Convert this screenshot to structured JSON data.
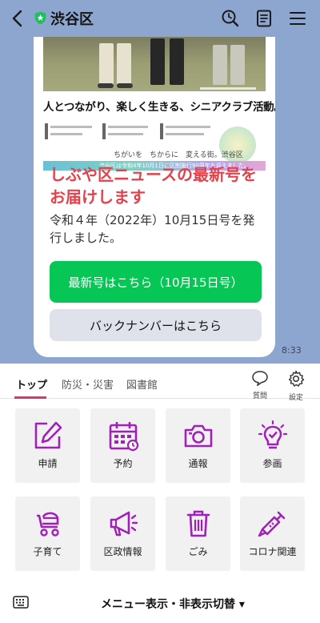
{
  "header": {
    "title": "渋谷区",
    "icons": [
      "back-icon",
      "verified-badge-icon",
      "search-clock-icon",
      "notes-icon",
      "menu-icon"
    ]
  },
  "message": {
    "leaflet_headline": "人とつながり、楽しく生きる、シニアクラブ活動。",
    "leaflet_slogan": "ちがいを　ちからに　変える街。渋谷区",
    "leaflet_stripe": "渋谷区は令和4年10月1日に区制施行90周年を迎えました。",
    "news_title": "しぶや区ニュースの最新号をお届けします",
    "news_desc": "令和４年（2022年）10月15日号を発行しました。",
    "primary_button": "最新号はこちら（10月15日号）",
    "secondary_button": "バックナンバーはこちら",
    "time": "8:33"
  },
  "richmenu": {
    "tabs": [
      "トップ",
      "防災・災害",
      "図書館"
    ],
    "active_tab": 0,
    "tools": [
      {
        "label": "質問",
        "icon": "chat-bubble-icon"
      },
      {
        "label": "設定",
        "icon": "gear-icon"
      }
    ],
    "tiles": [
      {
        "label": "申請",
        "icon": "edit-icon"
      },
      {
        "label": "予約",
        "icon": "calendar-icon"
      },
      {
        "label": "通報",
        "icon": "camera-icon"
      },
      {
        "label": "参画",
        "icon": "idea-bulb-icon"
      },
      {
        "label": "子育て",
        "icon": "stroller-icon"
      },
      {
        "label": "区政情報",
        "icon": "megaphone-icon"
      },
      {
        "label": "ごみ",
        "icon": "trash-icon"
      },
      {
        "label": "コロナ関連",
        "icon": "syringe-icon"
      }
    ],
    "accent_color": "#a020b8"
  },
  "bottom": {
    "menu_toggle": "メニュー表示・非表示切替 ▾",
    "keyboard_icon": "keyboard-icon"
  }
}
